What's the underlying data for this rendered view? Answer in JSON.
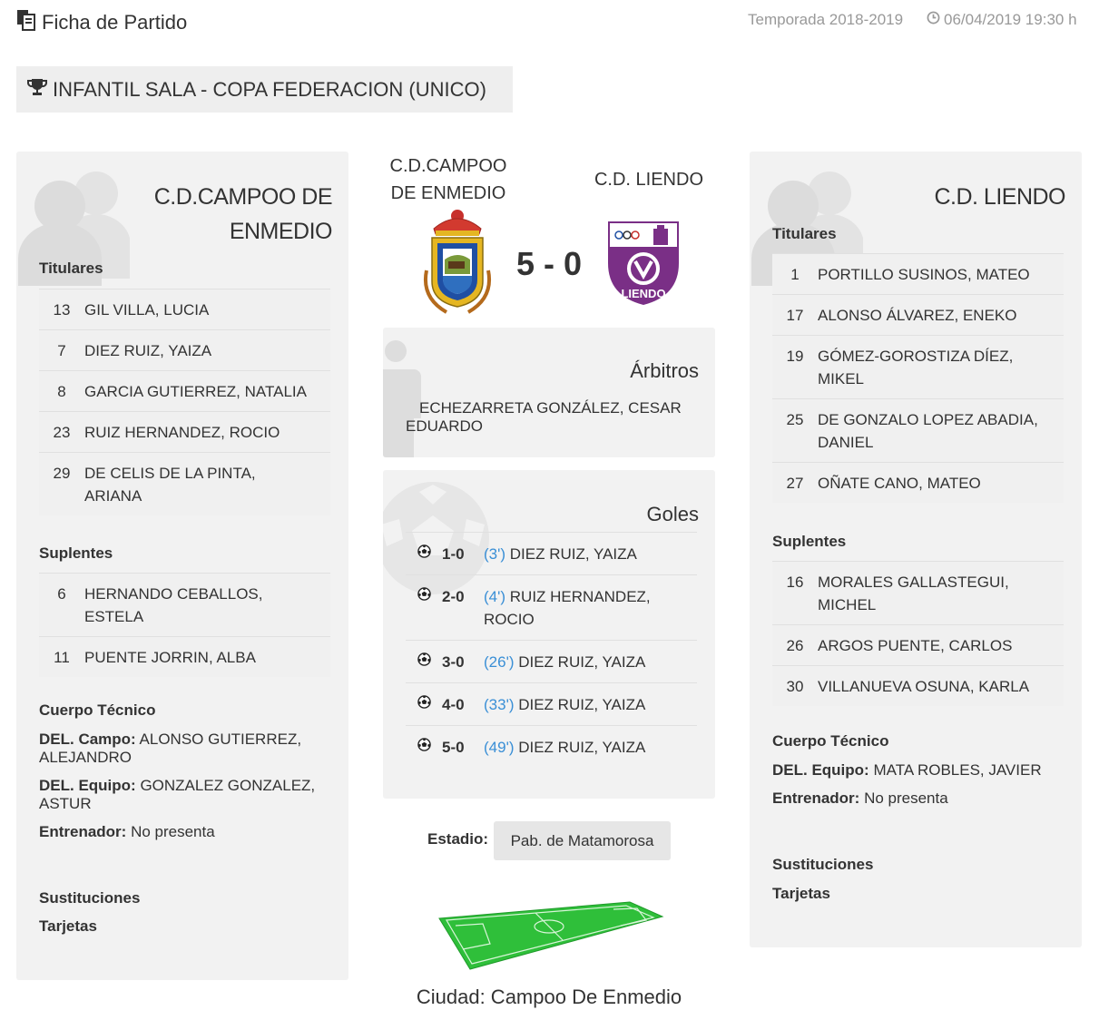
{
  "header": {
    "title": "Ficha de Partido",
    "season": "Temporada 2018-2019",
    "datetime": "06/04/2019 19:30 h"
  },
  "competition": "INFANTIL SALA - COPA FEDERACION (UNICO)",
  "home": {
    "name": "C.D.CAMPOO DE ENMEDIO",
    "center_name": "C.D.CAMPOO DE ENMEDIO",
    "starters_label": "Titulares",
    "starters": [
      {
        "num": "13",
        "name": "GIL VILLA, LUCIA"
      },
      {
        "num": "7",
        "name": "DIEZ RUIZ, YAIZA"
      },
      {
        "num": "8",
        "name": "GARCIA GUTIERREZ, NATALIA"
      },
      {
        "num": "23",
        "name": "RUIZ HERNANDEZ, ROCIO"
      },
      {
        "num": "29",
        "name": "DE CELIS DE LA PINTA, ARIANA"
      }
    ],
    "subs_label": "Suplentes",
    "subs": [
      {
        "num": "6",
        "name": "HERNANDO CEBALLOS, ESTELA"
      },
      {
        "num": "11",
        "name": "PUENTE JORRIN, ALBA"
      }
    ],
    "staff_label": "Cuerpo Técnico",
    "staff": [
      {
        "role": "DEL. Campo:",
        "name": "ALONSO GUTIERREZ, ALEJANDRO"
      },
      {
        "role": "DEL. Equipo:",
        "name": "GONZALEZ GONZALEZ, ASTUR"
      },
      {
        "role": "Entrenador:",
        "name": "No presenta"
      }
    ],
    "substitutions_label": "Sustituciones",
    "cards_label": "Tarjetas"
  },
  "away": {
    "name": "C.D. LIENDO",
    "center_name": "C.D. LIENDO",
    "crest_text": "LIENDO",
    "starters_label": "Titulares",
    "starters": [
      {
        "num": "1",
        "name": "PORTILLO SUSINOS, MATEO"
      },
      {
        "num": "17",
        "name": "ALONSO ÁLVAREZ, ENEKO"
      },
      {
        "num": "19",
        "name": "GÓMEZ-GOROSTIZA DÍEZ, MIKEL"
      },
      {
        "num": "25",
        "name": "DE GONZALO LOPEZ ABADIA, DANIEL"
      },
      {
        "num": "27",
        "name": "OÑATE CANO, MATEO"
      }
    ],
    "subs_label": "Suplentes",
    "subs": [
      {
        "num": "16",
        "name": "MORALES GALLASTEGUI, MICHEL"
      },
      {
        "num": "26",
        "name": "ARGOS PUENTE, CARLOS"
      },
      {
        "num": "30",
        "name": "VILLANUEVA OSUNA, KARLA"
      }
    ],
    "staff_label": "Cuerpo Técnico",
    "staff": [
      {
        "role": "DEL. Equipo:",
        "name": "MATA ROBLES, JAVIER"
      },
      {
        "role": "Entrenador:",
        "name": "No presenta"
      }
    ],
    "substitutions_label": "Sustituciones",
    "cards_label": "Tarjetas"
  },
  "score": "5 - 0",
  "referees": {
    "title": "Árbitros",
    "name": "ECHEZARRETA GONZÁLEZ, CESAR EDUARDO"
  },
  "goals": {
    "title": "Goles",
    "items": [
      {
        "result": "1-0",
        "minute": "(3')",
        "player": "DIEZ RUIZ, YAIZA"
      },
      {
        "result": "2-0",
        "minute": "(4')",
        "player": "RUIZ HERNANDEZ, ROCIO"
      },
      {
        "result": "3-0",
        "minute": "(26')",
        "player": "DIEZ RUIZ, YAIZA"
      },
      {
        "result": "4-0",
        "minute": "(33')",
        "player": "DIEZ RUIZ, YAIZA"
      },
      {
        "result": "5-0",
        "minute": "(49')",
        "player": "DIEZ RUIZ, YAIZA"
      }
    ]
  },
  "stadium": {
    "label": "Estadio:",
    "value": "Pab. de Matamorosa"
  },
  "city": "Ciudad: Campoo De Enmedio",
  "colors": {
    "panel_bg": "#f2f2f2",
    "minute_link": "#3a8fd6",
    "muted_text": "#999999",
    "pitch_green": "#2fbf3a",
    "away_purple": "#7a2f86"
  }
}
